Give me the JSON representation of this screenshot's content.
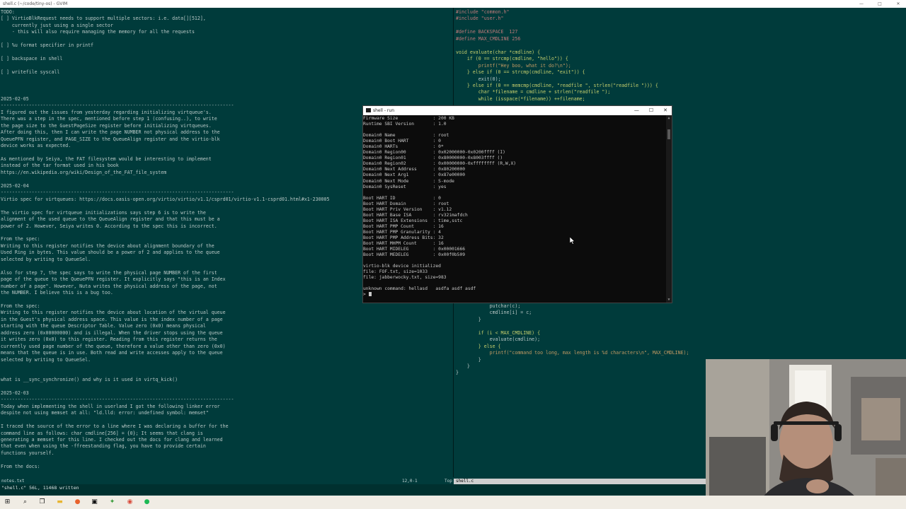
{
  "window_title": "shell.c (~/code/tiny-os) - GVIM",
  "window_controls": [
    "—",
    "□",
    "✕"
  ],
  "left_lines": [
    "TODO:",
    "[ ] VirtioBlkRequest needs to support multiple sectors: i.e. data[][512],",
    "    currently just using a single sector",
    "    - this will also require managing the memory for all the requests",
    "",
    "[ ] %u format specifier in printf",
    "",
    "[ ] backspace in shell",
    "",
    "[ ] writefile syscall",
    "",
    "",
    "",
    "2025-02-05",
    "-----------------------------------------------------------------------------------",
    "I figured out the issues from yesterday regarding initializing virtqueue's.",
    "There was a step in the spec, mentioned before step 1 (confusing..), to write",
    "the page size to the GuestPageSize register before initializing virtqueues.",
    "After doing this, then I can write the page NUMBER not physical address to the",
    "QueuePFN register, and PAGE_SIZE to the QueueAlign register and the virtio-blk",
    "device works as expected.",
    "",
    "As mentioned by Seiya, the FAT filesystem would be interesting to implement",
    "instead of the tar format used in his book",
    "https://en.wikipedia.org/wiki/Design_of_the_FAT_file_system",
    "",
    "2025-02-04",
    "-----------------------------------------------------------------------------------",
    "Virtio spec for virtqueues: https://docs.oasis-open.org/virtio/virtio/v1.1/csprd01/virtio-v1.1-csprd01.html#x1-230005",
    "",
    "The virtio spec for virtqueue initializations says step 6 is to write the",
    "alignment of the used queue to the QueueAlign register and that this must be a",
    "power of 2. However, Seiya writes 0. According to the spec this is incorrect.",
    "",
    "From the spec:",
    "Writing to this register notifies the device about alignment boundary of the",
    "Used Ring in bytes. This value should be a power of 2 and applies to the queue",
    "selected by writing to QueueSel.",
    "",
    "Also for step 7, the spec says to write the physical page NUMBER of the first",
    "page of the queue to the QueuePFN register. It explicitly says \"this is an Index",
    "number of a page\". However, Nuta writes the physical address of the page, not",
    "the NUMBER. I believe this is a bug too.",
    "",
    "From the spec:",
    "Writing to this register notifies the device about location of the virtual queue",
    "in the Guest's physical address space. This value is the index number of a page",
    "starting with the queue Descriptor Table. Value zero (0x0) means physical",
    "address zero (0x00000000) and is illegal. When the driver stops using the queue",
    "it writes zero (0x0) to this register. Reading from this register returns the",
    "currently used page number of the queue, therefore a value other than zero (0x0)",
    "means that the queue is in use. Both read and write accesses apply to the queue",
    "selected by writing to QueueSel.",
    "",
    "",
    "what is __sync_synchronize() and why is it used in virtq_kick()",
    "",
    "2025-02-03",
    "-----------------------------------------------------------------------------------",
    "Today when implementing the shell in userland I got the following linker error",
    "despite not using memset at all: \"ld.lld: error: undefined symbol: memset\"",
    "",
    "I traced the source of the error to a line where I was declaring a buffer for the",
    "command line as follows: char cmdline[256] = {0}; It seems that clang is",
    "generating a memset for this line. I checked out the docs for clang and learned",
    "that even when using the -ffreestanding flag, you have to provide certain",
    "functions yourself.",
    "",
    "From the docs:"
  ],
  "right_lines": [
    "#include \"common.h\"",
    "#include \"user.h\"",
    "",
    "#define BACKSPACE  127",
    "#define MAX_CMDLINE 256",
    "",
    "void evaluate(char *cmdline) {",
    "    if (0 == strcmp(cmdline, \"hello\")) {",
    "        printf(\"Hey boo, what it do?\\n\");",
    "    } else if (0 == strcmp(cmdline, \"exit\")) {",
    "        exit(0);",
    "    } else if (0 == memcmp(cmdline, \"readfile \", strlen(\"readfile \"))) {",
    "        char *filename = cmdline + strlen(\"readfile \");",
    "        while (isspace(*filename)) ++filename;",
    "",
    "",
    "",
    "",
    "",
    "",
    "",
    "",
    "",
    "",
    "",
    "",
    "",
    "",
    "",
    "",
    "",
    "",
    "",
    "",
    "",
    "",
    "",
    "",
    "",
    "",
    "",
    "",
    "",
    "",
    "            putchar(c);",
    "            cmdline[i] = c;",
    "        }",
    "",
    "        if (i < MAX_CMDLINE) {",
    "            evaluate(cmdline);",
    "        } else {",
    "            printf(\"command too long, max length is %d characters\\n\", MAX_CMDLINE);",
    "        }",
    "    }",
    "}"
  ],
  "status_left": {
    "filename": "notes.txt",
    "position": "12,0-1",
    "scroll": "Top"
  },
  "status_right": {
    "filename": "shell.c"
  },
  "command_line": "\"shell.c\" 56L, 11468 written",
  "run_window": {
    "title": "shell - run",
    "controls": [
      "—",
      "☐",
      "✕"
    ],
    "lines": [
      "Firmware Size             : 200 KB",
      "Runtime SBI Version       : 1.0",
      "",
      "Domain0 Name              : root",
      "Domain0 Boot HART         : 0",
      "Domain0 HARTs             : 0*",
      "Domain0 Region00          : 0x02000000-0x0200ffff (I)",
      "Domain0 Region01          : 0x80000000-0x8003ffff ()",
      "Domain0 Region02          : 0x00000000-0xffffffff (R,W,X)",
      "Domain0 Next Address      : 0x80200000",
      "Domain0 Next Arg1         : 0x87e00000",
      "Domain0 Next Mode         : S-mode",
      "Domain0 SysReset          : yes",
      "",
      "Boot HART ID              : 0",
      "Boot HART Domain          : root",
      "Boot HART Priv Version    : v1.12",
      "Boot HART Base ISA        : rv32imafdch",
      "Boot HART ISA Extensions  : time,sstc",
      "Boot HART PMP Count       : 16",
      "Boot HART PMP Granularity : 4",
      "Boot HART PMP Address Bits: 32",
      "Boot HART MHPM Count      : 16",
      "Boot HART MIDELEG         : 0x00001666",
      "Boot HART MEDELEG         : 0x00f0b509",
      "",
      "virtio-blk device initialized",
      "file: FOF.txt, size=1033",
      "file: jabberwocky.txt, size=983",
      "",
      "unknown command: hellasd   asdfa asdf asdf",
      "> "
    ]
  },
  "taskbar": {
    "icons": [
      {
        "name": "windows-start-icon",
        "glyph": "⊞",
        "color": "#1a1a1a"
      },
      {
        "name": "search-icon",
        "glyph": "⌕",
        "color": "#1a1a1a"
      },
      {
        "name": "task-view-icon",
        "glyph": "❐",
        "color": "#1a1a1a"
      },
      {
        "name": "file-explorer-icon",
        "glyph": "▬",
        "color": "#e8b530"
      },
      {
        "name": "firefox-icon",
        "glyph": "●",
        "color": "#e8622c"
      },
      {
        "name": "terminal-icon",
        "glyph": "▣",
        "color": "#111111"
      },
      {
        "name": "gvim-icon",
        "glyph": "✦",
        "color": "#3a9c3a"
      },
      {
        "name": "chrome-icon",
        "glyph": "◉",
        "color": "#d84a3a"
      },
      {
        "name": "spotify-icon",
        "glyph": "●",
        "color": "#1db954"
      }
    ]
  },
  "colors": {
    "background": "#003b3b",
    "text": "#b9c8c6",
    "keyword": "#c6cf6d",
    "string": "#c39a63",
    "preprocessor": "#c07a7a",
    "terminal_bg": "#0c0c0c"
  }
}
